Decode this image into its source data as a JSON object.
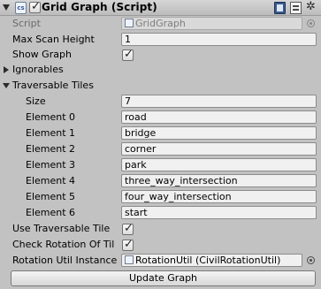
{
  "header": {
    "title": "Grid Graph (Script)",
    "enabled": true
  },
  "fields": {
    "script_label": "Script",
    "script_value": "GridGraph",
    "max_scan_height_label": "Max Scan Height",
    "max_scan_height_value": "1",
    "show_graph_label": "Show Graph",
    "show_graph_checked": true,
    "ignorables_label": "Ignorables",
    "traversable_tiles_label": "Traversable Tiles",
    "size_label": "Size",
    "size_value": "7",
    "use_traversable_tile_label": "Use Traversable Tile",
    "use_traversable_tile_checked": true,
    "check_rotation_label": "Check Rotation Of Til",
    "check_rotation_checked": true,
    "rotation_util_label": "Rotation Util Instance",
    "rotation_util_value": "RotationUtil (CivilRotationUtil)"
  },
  "elements": [
    {
      "label": "Element 0",
      "value": "road"
    },
    {
      "label": "Element 1",
      "value": "bridge"
    },
    {
      "label": "Element 2",
      "value": "corner"
    },
    {
      "label": "Element 3",
      "value": "park"
    },
    {
      "label": "Element 4",
      "value": "three_way_intersection"
    },
    {
      "label": "Element 5",
      "value": "four_way_intersection"
    },
    {
      "label": "Element 6",
      "value": "start"
    }
  ],
  "update_button": "Update Graph"
}
